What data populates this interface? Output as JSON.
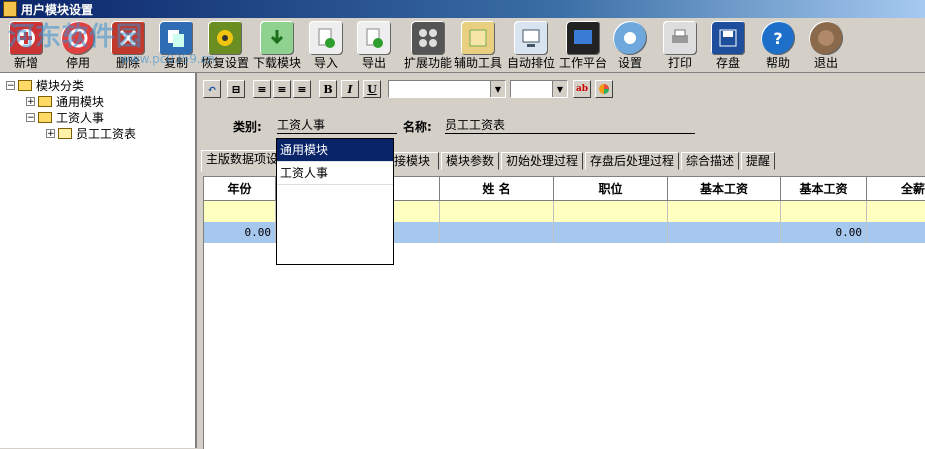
{
  "window": {
    "title": "用户模块设置"
  },
  "toolbar": {
    "buttons": [
      {
        "label": "新增",
        "icon": "new-icon"
      },
      {
        "label": "停用",
        "icon": "disable-icon"
      },
      {
        "label": "删除",
        "icon": "delete-icon"
      },
      {
        "label": "复制",
        "icon": "copy-icon"
      },
      {
        "label": "恢复设置",
        "icon": "restore-icon"
      },
      {
        "label": "下载模块",
        "icon": "download-icon"
      },
      {
        "label": "导入",
        "icon": "import-icon"
      },
      {
        "label": "导出",
        "icon": "export-icon"
      },
      {
        "label": "扩展功能",
        "icon": "extend-icon"
      },
      {
        "label": "辅助工具",
        "icon": "tools-icon"
      },
      {
        "label": "自动排位",
        "icon": "auto-arrange-icon"
      },
      {
        "label": "工作平台",
        "icon": "workbench-icon"
      },
      {
        "label": "设置",
        "icon": "settings-icon"
      },
      {
        "label": "打印",
        "icon": "print-icon"
      },
      {
        "label": "存盘",
        "icon": "save-icon"
      },
      {
        "label": "帮助",
        "icon": "help-icon"
      },
      {
        "label": "退出",
        "icon": "exit-icon"
      }
    ]
  },
  "watermark": {
    "text": "河东软件园",
    "url": "www.pc0359.cn"
  },
  "tree": {
    "root": "模块分类",
    "children": [
      "通用模块",
      "工资人事"
    ],
    "leaf": "员工工资表"
  },
  "format_bar": {
    "bold": "B",
    "italic": "I",
    "underline": "U",
    "font_value": "",
    "size_value": ""
  },
  "form": {
    "category_label": "类别:",
    "category_value": "工资人事",
    "name_label": "名称:",
    "name_value": "员工工资表"
  },
  "tabs": [
    "主版数据项设",
    "链接模块",
    "模块参数",
    "初始处理过程",
    "存盘后处理过程",
    "综合描述",
    "提醒"
  ],
  "grid": {
    "columns": [
      "年份",
      "",
      "姓 名",
      "职位",
      "基本工资",
      "基本工资",
      "全薪"
    ],
    "rows": [
      {
        "cells": [
          "",
          "",
          "",
          "",
          "",
          "",
          ""
        ]
      },
      {
        "cells": [
          "0.00",
          "",
          "",
          "",
          "",
          "0.00",
          ""
        ]
      }
    ]
  },
  "dropdown": {
    "options": [
      "通用模块",
      "工资人事"
    ],
    "selected": "通用模块"
  }
}
